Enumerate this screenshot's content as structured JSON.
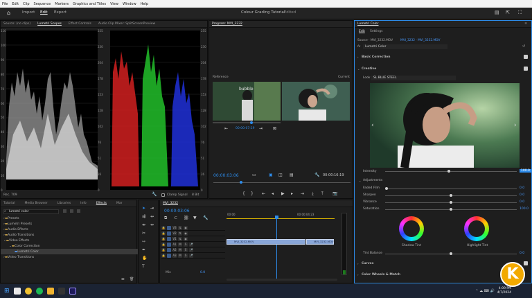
{
  "menubar": {
    "items": [
      "File",
      "Edit",
      "Clip",
      "Sequence",
      "Markers",
      "Graphics and Titles",
      "View",
      "Window",
      "Help"
    ]
  },
  "workspace": {
    "tabs": [
      "Import",
      "Edit",
      "Export"
    ],
    "active_tab": "Edit",
    "title": "Colour Grading Tutorial",
    "title_status": "- Edited"
  },
  "left_panel": {
    "tabs": [
      "Source: (no clips)",
      "Lumetri Scopes",
      "Effect Controls",
      "Audio Clip Mixer: SplitScreenPreview"
    ],
    "left_axis": [
      "110",
      "100",
      "90",
      "80",
      "70",
      "60",
      "50",
      "40",
      "30",
      "20",
      "10",
      "0"
    ],
    "mid_axis": [
      "255",
      "230",
      "204",
      "178",
      "153",
      "128",
      "102",
      "76",
      "51",
      "26",
      "0"
    ],
    "right_axis": [
      "110",
      "100",
      "90",
      "80",
      "70",
      "60",
      "50",
      "40",
      "30",
      "20",
      "10",
      "0"
    ],
    "right_axis2": [
      "255",
      "230",
      "204",
      "178",
      "153",
      "128",
      "102",
      "76",
      "51",
      "26",
      "0"
    ],
    "footer_left": "Rec. 709",
    "clamp_label": "Clamp Signal",
    "bits_value": "8 Bit"
  },
  "program": {
    "title": "Program: MVI_3232",
    "reference_label": "Reference",
    "current_label": "Current",
    "ref_timecode": "00:00:07:19",
    "timecode": "00:00:03:06",
    "duration": "00:00:16:19"
  },
  "project_panel": {
    "tabs": [
      "Tutorial",
      "Media Browser",
      "Libraries",
      "Info",
      "Effects",
      "Mar"
    ],
    "active_tab": "Effects",
    "search_value": "lumetri color",
    "items": [
      {
        "label": "Presets",
        "indent": 0
      },
      {
        "label": "Lumetri Presets",
        "indent": 0
      },
      {
        "label": "Audio Effects",
        "indent": 0
      },
      {
        "label": "Audio Transitions",
        "indent": 0
      },
      {
        "label": "Video Effects",
        "indent": 0
      },
      {
        "label": "Color Correction",
        "indent": 1
      },
      {
        "label": "Lumetri Color",
        "indent": 2
      },
      {
        "label": "Video Transitions",
        "indent": 0
      }
    ]
  },
  "timeline": {
    "title": "MVI_3232",
    "timecode": "00:00:03:06",
    "ruler": [
      "00:00",
      "00:00:04:23"
    ],
    "video_tracks": [
      "V3",
      "V2",
      "V1"
    ],
    "audio_tracks": [
      "A1",
      "A2",
      "A3"
    ],
    "mix_label": "Mix",
    "mix_value": "0.0",
    "clip1": "MVI_3232.MOV",
    "clip2": "MVI_3232.MOV"
  },
  "lumetri": {
    "title": "Lumetri Color",
    "tabs": [
      "Edit",
      "Settings"
    ],
    "source": "Source · MVI_3232.MOV",
    "source_seq": "MVI_3232 · MVI_3232.MOV",
    "fx_label": "Lumetri Color",
    "sections": {
      "basic": "Basic Correction",
      "creative": "Creative",
      "curves": "Curves",
      "wheels": "Color Wheels & Match"
    },
    "look_label": "Look",
    "look_value": "SL BLUE STEEL",
    "intensity_label": "Intensity",
    "intensity_value": "100.0",
    "adjustments_label": "Adjustments",
    "sliders": [
      {
        "label": "Faded Film",
        "value": "0.0",
        "level": 0
      },
      {
        "label": "Sharpen",
        "value": "0.0",
        "level": 0.5
      },
      {
        "label": "Vibrance",
        "value": "0.0",
        "level": 0.5
      },
      {
        "label": "Saturation",
        "value": "100.0",
        "level": 0.5
      }
    ],
    "shadow_tint": "Shadow Tint",
    "highlight_tint": "Highlight Tint",
    "tint_balance_label": "Tint Balance",
    "tint_balance_value": "0.0"
  },
  "taskbar": {
    "time": "4:09 PM",
    "date": "4/7/2024"
  },
  "colors": {
    "accent": "#2d8ceb",
    "clip": "#8aa7d8",
    "timecode": "#2d8ceb"
  }
}
